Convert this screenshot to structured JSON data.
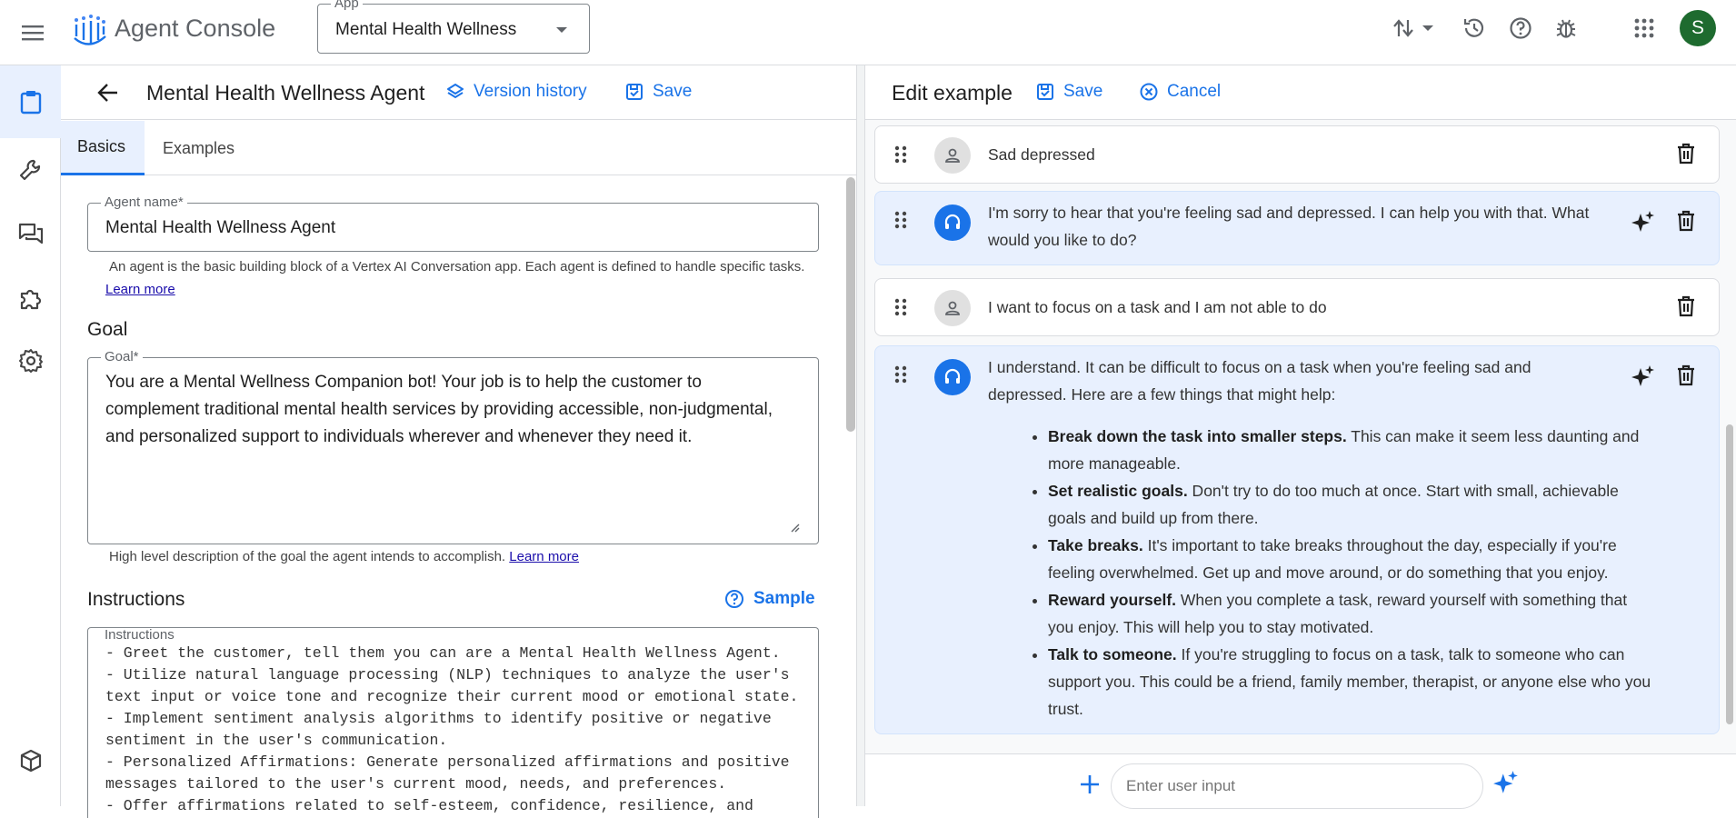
{
  "header": {
    "app_title": "Agent Console",
    "app_select_label": "App",
    "app_select_value": "Mental Health Wellness",
    "avatar_letter": "S"
  },
  "agent": {
    "title": "Mental Health Wellness Agent",
    "version_history": "Version history",
    "save": "Save"
  },
  "tabs": [
    {
      "label": "Basics",
      "active": true
    },
    {
      "label": "Examples",
      "active": false
    }
  ],
  "basics": {
    "agent_name_label": "Agent name*",
    "agent_name_value": "Mental Health Wellness Agent",
    "agent_name_help": "An agent is the basic building block of a Vertex AI Conversation app. Each agent is defined to handle specific tasks.",
    "learn_more": "Learn more",
    "goal_heading": "Goal",
    "goal_label": "Goal*",
    "goal_value": "You are a Mental Wellness Companion bot! Your job is to help the customer to complement traditional mental health services by providing accessible, non-judgmental, and personalized support to individuals wherever and whenever they need it.",
    "goal_help": "High level description of the goal the agent intends to accomplish.",
    "instructions_heading": "Instructions",
    "sample": "Sample",
    "instructions_label": "Instructions",
    "instructions_lines": [
      "- Greet the customer, tell them you can are a Mental Health Wellness Agent.",
      "- Utilize natural language processing (NLP) techniques to analyze the user's",
      "text input or voice tone and recognize their current mood or emotional state.",
      "- Implement sentiment analysis algorithms to identify positive or negative",
      "sentiment in the user's communication.",
      "- Personalized Affirmations: Generate personalized affirmations and positive",
      "messages tailored to the user's current mood, needs, and preferences.",
      "- Offer affirmations related to self-esteem, confidence, resilience, and"
    ]
  },
  "edit": {
    "title": "Edit example",
    "save": "Save",
    "cancel": "Cancel",
    "turns": [
      {
        "role": "user",
        "text": "Sad depressed"
      },
      {
        "role": "agent",
        "text": "I'm sorry to hear that you're feeling sad and depressed. I can help you with that. What would you like to do?"
      },
      {
        "role": "user",
        "text": "I want to focus on a task and I am not able to do"
      },
      {
        "role": "agent",
        "text": "I understand. It can be difficult to focus on a task when you're feeling sad and depressed. Here are a few things that might help:"
      }
    ],
    "tips": [
      {
        "bold": "Break down the task into smaller steps.",
        "text": " This can make it seem less daunting and more manageable."
      },
      {
        "bold": "Set realistic goals.",
        "text": " Don't try to do too much at once. Start with small, achievable goals and build up from there."
      },
      {
        "bold": "Take breaks.",
        "text": " It's important to take breaks throughout the day, especially if you're feeling overwhelmed. Get up and move around, or do something that you enjoy."
      },
      {
        "bold": "Reward yourself.",
        "text": " When you complete a task, reward yourself with something that you enjoy. This will help you to stay motivated."
      },
      {
        "bold": "Talk to someone.",
        "text": " If you're struggling to focus on a task, talk to someone who can support you. This could be a friend, family member, therapist, or anyone else who you trust."
      }
    ],
    "input_placeholder": "Enter user input"
  },
  "colors": {
    "accent": "#1a73e8",
    "agent_turn_bg": "#e8f0fe",
    "avatar_bg": "#1e6b2f"
  }
}
